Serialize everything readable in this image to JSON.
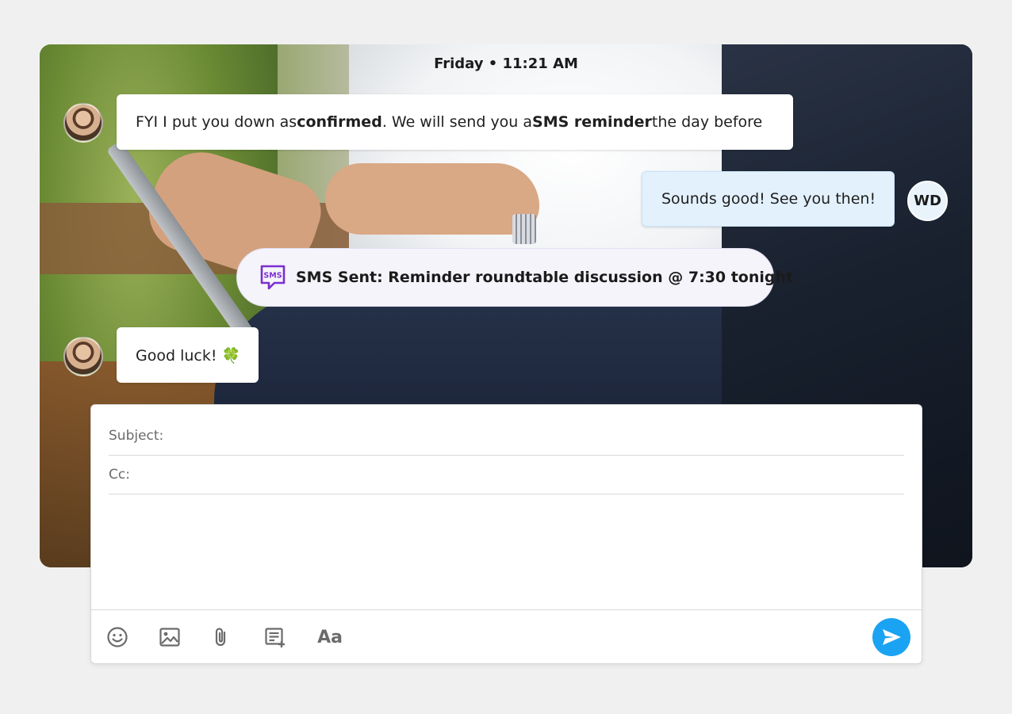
{
  "chat": {
    "timestamp": "Friday • 11:21 AM",
    "messages": [
      {
        "sender": "agent",
        "parts": [
          "FYI I put you down as ",
          "confirmed",
          ". We will send you a ",
          "SMS reminder",
          " the day before"
        ]
      },
      {
        "sender": "user",
        "avatar_initials": "WD",
        "text": "Sounds good! See you then!"
      },
      {
        "type": "sms-event",
        "icon_label": "SMS",
        "text": "SMS Sent: Reminder roundtable discussion @ 7:30 tonight"
      },
      {
        "sender": "agent",
        "text": "Good luck! 🍀"
      }
    ]
  },
  "composer": {
    "subject_label": "Subject:",
    "subject_value": "",
    "cc_label": "Cc:",
    "cc_value": "",
    "body_value": "",
    "toolbar": [
      {
        "name": "emoji-icon"
      },
      {
        "name": "image-icon"
      },
      {
        "name": "attachment-icon"
      },
      {
        "name": "snippet-add-icon"
      },
      {
        "name": "format-text-icon",
        "label": "Aa"
      },
      {
        "name": "send-icon"
      }
    ]
  },
  "colors": {
    "send_button": "#1aa3f2",
    "sms_icon": "#7b2fd0",
    "mine_bubble": "#e3f1fd"
  }
}
